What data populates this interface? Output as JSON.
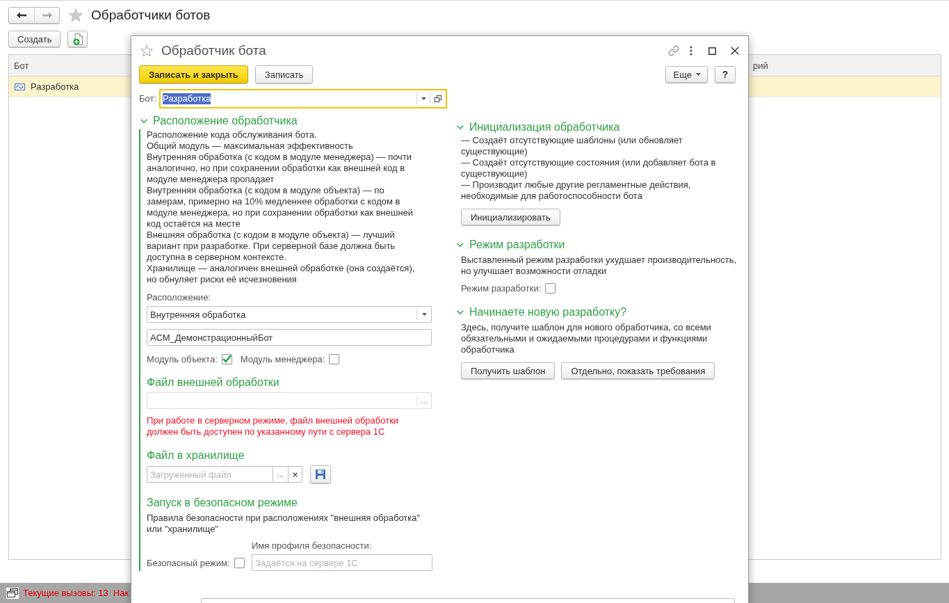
{
  "window": {
    "title": "Обработчики ботов",
    "nav_buttons": [
      {
        "kind": "back",
        "disabled": false
      },
      {
        "kind": "forward",
        "disabled": true
      }
    ]
  },
  "toolbar": {
    "buttons": [
      {
        "kind": "text",
        "label": "Создать"
      },
      {
        "kind": "add_document"
      }
    ]
  },
  "table": {
    "columns": [
      "Бот",
      "рий"
    ],
    "rows": [
      {
        "cells": [
          "Разработка"
        ],
        "selected": true
      }
    ]
  },
  "status_bar": {
    "items": [
      "Текущие вызовы: 13",
      "Нак"
    ]
  },
  "dialog": {
    "title": "Обработчик бота",
    "toolbar": {
      "buttons": [
        {
          "label": "Записать и закрыть",
          "kind": "primary"
        },
        {
          "label": "Записать",
          "kind": "default"
        }
      ],
      "more": "Еще",
      "help": "?"
    },
    "bot_field": {
      "label": "Бот:",
      "value": "Разработка",
      "focused": true,
      "highlighted": true
    },
    "location": {
      "title": "Расположение обработчика",
      "expanded": true,
      "description": "Расположение кода обслуживания бота.\nОбщий модуль — максимальная эффективность\nВнутренняя обработка (с кодом в модуле менеджера) — почти аналогично, но при сохранении обработки как внешней код в модуле менеджера пропадает\nВнутренняя обработка (с кодом в модуле объекта) — по замерам, примерно на 10% медленнее обработки с кодом в модуле менеджера, но при сохранении обработки как внешней код остаётся на месте\nВнешняя обработка (с кодом в модуле объекта) — лучший вариант при разработке. При серверной базе должна быть доступна в серверном контексте.\nХранилище — аналогичен внешней обработке (она создаётся), но обнуляет риски её исчезновения",
      "location_label": "Расположение:",
      "location_value": "Внутренняя обработка",
      "name_value": "АСМ_ДемонстрационныйБот",
      "modules": [
        {
          "label": "Модуль объекта:",
          "checked": true
        },
        {
          "label": "Модуль менеджера:",
          "checked": false
        }
      ],
      "external_file": {
        "title": "Файл внешней обработки",
        "warning": "При работе в серверном режиме, файл внешней обработки должен быть доступен по указанному пути с сервера 1С"
      },
      "storage_file": {
        "title": "Файл в хранилище",
        "placeholder": "Загруженный файл"
      },
      "safe_mode": {
        "title": "Запуск в безопасном режиме",
        "description": "Правила безопасности при расположениях \"внешняя обработка\" или \"хранилище\"",
        "profile_label": "Имя профиля безопасности:",
        "checkbox": {
          "label": "Безопасный режим:",
          "checked": false
        },
        "profile_placeholder": "Задаётся на сервере 1С"
      }
    },
    "side_groups": [
      {
        "kind": "buttons",
        "title": "Инициализация обработчика",
        "expanded": true,
        "description": "— Создаёт отсутствующие шаблоны (или обновляет существующие)\n— Создаёт отсутствующие состояния (или добавляет бота в существующие)\n— Производит любые другие регламентные действия, необходимые для работоспособности бота",
        "buttons": [
          "Инициализировать"
        ]
      },
      {
        "kind": "checkbox",
        "title": "Режим разработки",
        "expanded": true,
        "description": "Выставленный режим разработки ухудшает производительность, но улучшает возможности отладки",
        "checkbox": {
          "label": "Режим разработки:",
          "checked": false
        }
      },
      {
        "kind": "buttons",
        "title": "Начинаете новую разработку?",
        "expanded": true,
        "description": "Здесь, получите шаблон для нового обработчика, со всеми обязательными и ожидаемыми процедурами и функциями обработчика",
        "buttons": [
          "Получить шаблон",
          "Отдельно, показать требования"
        ]
      }
    ]
  }
}
